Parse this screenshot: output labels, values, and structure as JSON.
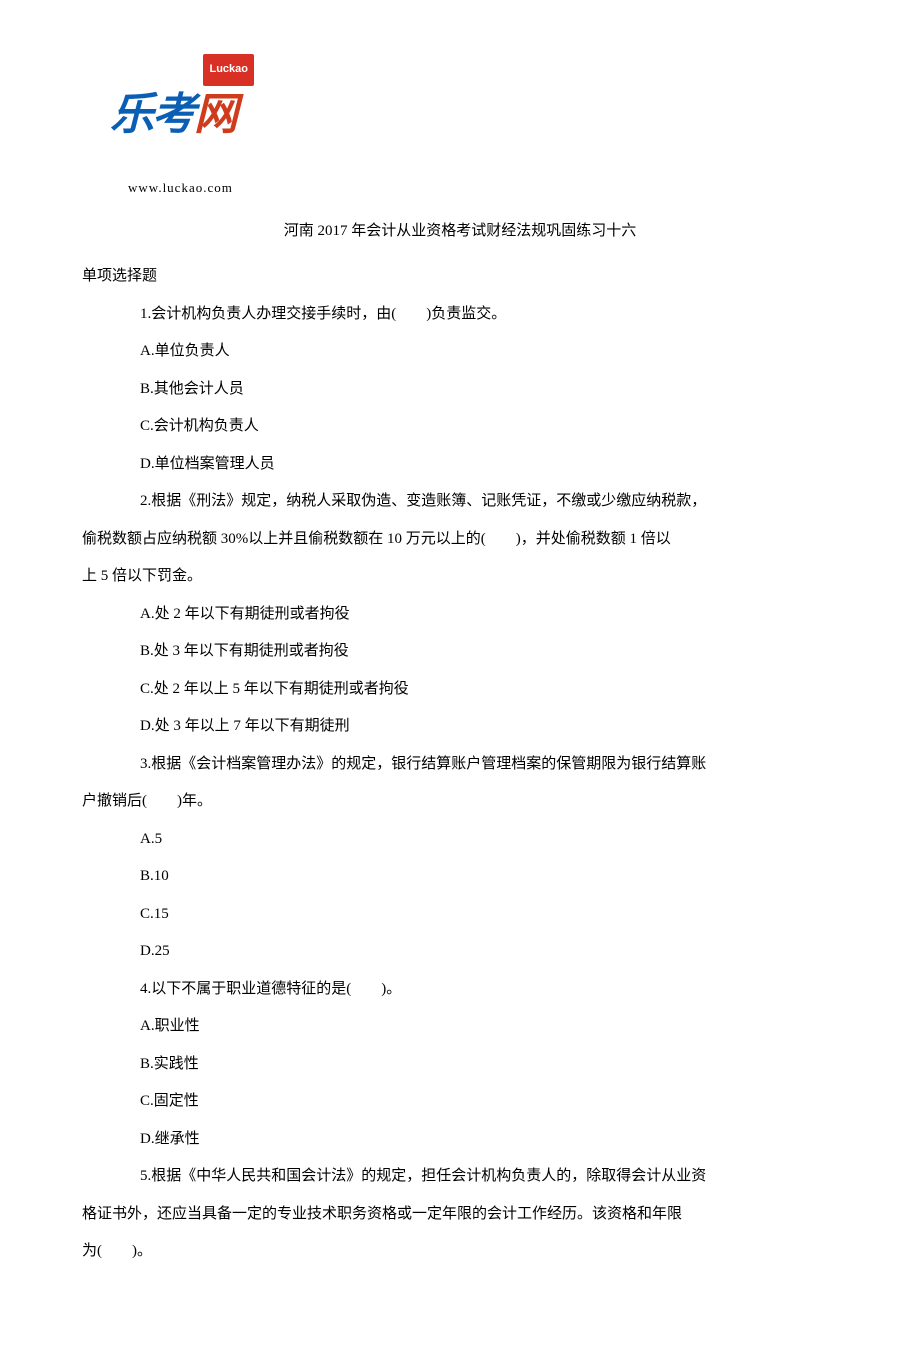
{
  "logo": {
    "badge": "Luckao",
    "char1": "乐",
    "char2": "考",
    "char3": "网",
    "url": "www.luckao.com"
  },
  "title": "河南 2017 年会计从业资格考试财经法规巩固练习十六",
  "section_label": "单项选择题",
  "q1": {
    "stem": "1.会计机构负责人办理交接手续时，由(　　)负责监交。",
    "a": "A.单位负责人",
    "b": "B.其他会计人员",
    "c": "C.会计机构负责人",
    "d": "D.单位档案管理人员"
  },
  "q2": {
    "stem_l1": "2.根据《刑法》规定，纳税人采取伪造、变造账簿、记账凭证，不缴或少缴应纳税款，",
    "stem_l2": "偷税数额占应纳税额 30%以上并且偷税数额在 10 万元以上的(　　)，并处偷税数额 1 倍以",
    "stem_l3": "上 5 倍以下罚金。",
    "a": "A.处 2 年以下有期徒刑或者拘役",
    "b": "B.处 3 年以下有期徒刑或者拘役",
    "c": "C.处 2 年以上 5 年以下有期徒刑或者拘役",
    "d": "D.处 3 年以上 7 年以下有期徒刑"
  },
  "q3": {
    "stem_l1": "3.根据《会计档案管理办法》的规定，银行结算账户管理档案的保管期限为银行结算账",
    "stem_l2": "户撤销后(　　)年。",
    "a": "A.5",
    "b": "B.10",
    "c": "C.15",
    "d": "D.25"
  },
  "q4": {
    "stem": "4.以下不属于职业道德特征的是(　　)。",
    "a": "A.职业性",
    "b": "B.实践性",
    "c": "C.固定性",
    "d": "D.继承性"
  },
  "q5": {
    "stem_l1": "5.根据《中华人民共和国会计法》的规定，担任会计机构负责人的，除取得会计从业资",
    "stem_l2": "格证书外，还应当具备一定的专业技术职务资格或一定年限的会计工作经历。该资格和年限",
    "stem_l3": "为(　　)。"
  }
}
